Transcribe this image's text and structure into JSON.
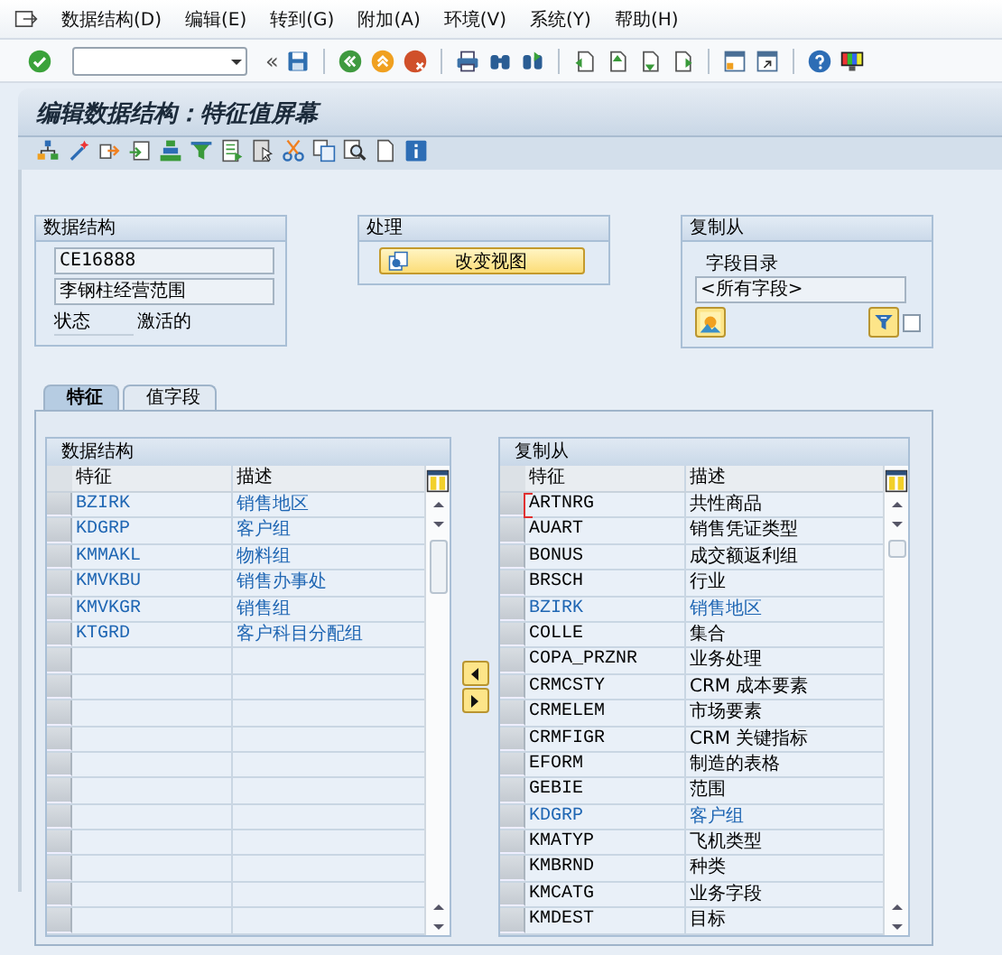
{
  "menu_bar": {
    "items": [
      "数据结构(D)",
      "编辑(E)",
      "转到(G)",
      "附加(A)",
      "环境(V)",
      "系统(Y)",
      "帮助(H)"
    ]
  },
  "toolbar": {
    "collapse_symbol": "«"
  },
  "title": "编辑数据结构：特征值屏幕",
  "groups": [
    {
      "kind": "structure",
      "title": "数据结构",
      "name": "CE16888",
      "description": "李钢柱经营范围",
      "status_label": "状态",
      "status_value": "激活的"
    },
    {
      "kind": "processing",
      "title": "处理",
      "button": "改变视图"
    },
    {
      "kind": "copy_from",
      "title": "复制从",
      "label": "字段目录",
      "value": "<所有字段>",
      "checked": false
    }
  ],
  "tabs": [
    {
      "label": "特征",
      "selected": true
    },
    {
      "label": "值字段",
      "selected": false
    }
  ],
  "tables": [
    {
      "title": "数据结构",
      "columns": [
        "特征",
        "描述"
      ],
      "rows": [
        {
          "characteristic": "BZIRK",
          "description": "销售地区",
          "used": true,
          "focused": false
        },
        {
          "characteristic": "KDGRP",
          "description": "客户组",
          "used": true,
          "focused": false
        },
        {
          "characteristic": "KMMAKL",
          "description": "物料组",
          "used": true,
          "focused": false
        },
        {
          "characteristic": "KMVKBU",
          "description": "销售办事处",
          "used": true,
          "focused": false
        },
        {
          "characteristic": "KMVKGR",
          "description": "销售组",
          "used": true,
          "focused": false
        },
        {
          "characteristic": "KTGRD",
          "description": "客户科目分配组",
          "used": true,
          "focused": false
        }
      ]
    },
    {
      "title": "复制从",
      "columns": [
        "特征",
        "描述"
      ],
      "rows": [
        {
          "characteristic": "ARTNRG",
          "description": "共性商品",
          "used": false,
          "focused": true
        },
        {
          "characteristic": "AUART",
          "description": "销售凭证类型",
          "used": false,
          "focused": false
        },
        {
          "characteristic": "BONUS",
          "description": "成交额返利组",
          "used": false,
          "focused": false
        },
        {
          "characteristic": "BRSCH",
          "description": "行业",
          "used": false,
          "focused": false
        },
        {
          "characteristic": "BZIRK",
          "description": "销售地区",
          "used": true,
          "focused": false
        },
        {
          "characteristic": "COLLE",
          "description": "集合",
          "used": false,
          "focused": false
        },
        {
          "characteristic": "COPA_PRZNR",
          "description": "业务处理",
          "used": false,
          "focused": false
        },
        {
          "characteristic": "CRMCSTY",
          "description": "CRM 成本要素",
          "used": false,
          "focused": false
        },
        {
          "characteristic": "CRMELEM",
          "description": "市场要素",
          "used": false,
          "focused": false
        },
        {
          "characteristic": "CRMFIGR",
          "description": "CRM 关键指标",
          "used": false,
          "focused": false
        },
        {
          "characteristic": "EFORM",
          "description": "制造的表格",
          "used": false,
          "focused": false
        },
        {
          "characteristic": "GEBIE",
          "description": "范围",
          "used": false,
          "focused": false
        },
        {
          "characteristic": "KDGRP",
          "description": "客户组",
          "used": true,
          "focused": false
        },
        {
          "characteristic": "KMATYP",
          "description": "飞机类型",
          "used": false,
          "focused": false
        },
        {
          "characteristic": "KMBRND",
          "description": "种类",
          "used": false,
          "focused": false
        },
        {
          "characteristic": "KMCATG",
          "description": "业务字段",
          "used": false,
          "focused": false
        },
        {
          "characteristic": "KMDEST",
          "description": "目标",
          "used": false,
          "focused": false
        }
      ]
    }
  ]
}
